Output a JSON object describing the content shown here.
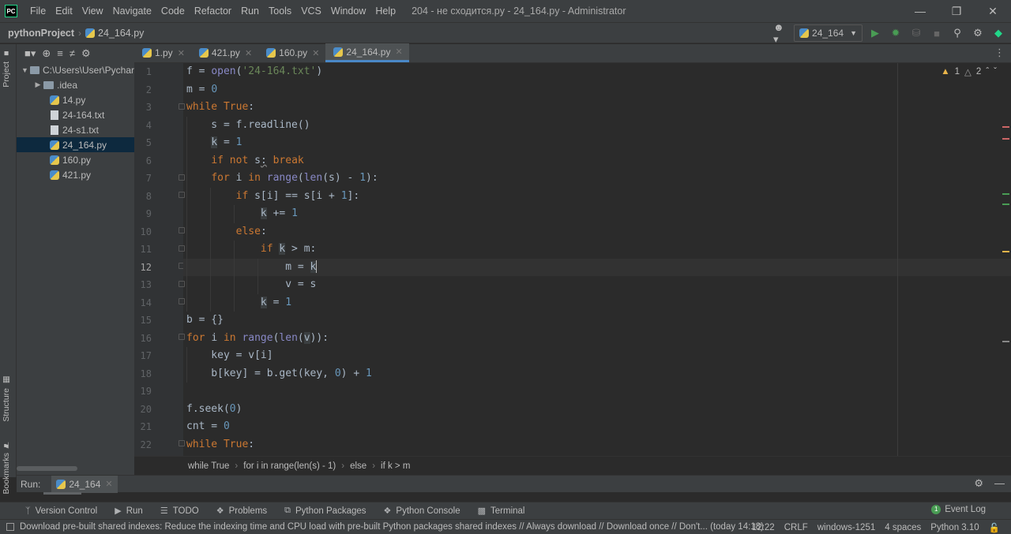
{
  "app": {
    "logo": "PC",
    "window_title": "204 - не сходится.py - 24_164.py - Administrator",
    "menu": [
      "File",
      "Edit",
      "View",
      "Navigate",
      "Code",
      "Refactor",
      "Run",
      "Tools",
      "VCS",
      "Window",
      "Help"
    ]
  },
  "navbar": {
    "project": "pythonProject",
    "file": "24_164.py",
    "run_config": "24_164"
  },
  "project_tree": {
    "root": "C:\\Users\\User\\Pychar",
    "items": [
      {
        "label": ".idea",
        "kind": "folder"
      },
      {
        "label": "14.py",
        "kind": "py"
      },
      {
        "label": "24-164.txt",
        "kind": "txt"
      },
      {
        "label": "24-s1.txt",
        "kind": "txt"
      },
      {
        "label": "24_164.py",
        "kind": "py",
        "selected": true
      },
      {
        "label": "160.py",
        "kind": "py"
      },
      {
        "label": "421.py",
        "kind": "py"
      }
    ]
  },
  "side_tabs": {
    "project": "Project",
    "structure": "Structure",
    "bookmarks": "Bookmarks"
  },
  "editor_tabs": [
    {
      "label": "1.py",
      "active": false
    },
    {
      "label": "421.py",
      "active": false
    },
    {
      "label": "160.py",
      "active": false
    },
    {
      "label": "24_164.py",
      "active": true
    }
  ],
  "inspections": {
    "warnings": "1",
    "weak_warnings": "2"
  },
  "code": {
    "current_line": 12,
    "line_numbers": [
      "1",
      "2",
      "3",
      "4",
      "5",
      "6",
      "7",
      "8",
      "9",
      "10",
      "11",
      "12",
      "13",
      "14",
      "15",
      "16",
      "17",
      "18",
      "19",
      "20",
      "21",
      "22"
    ]
  },
  "code_breadcrumbs": [
    "while True",
    "for i in range(len(s) - 1)",
    "else",
    "if k > m"
  ],
  "run_panel": {
    "label": "Run:",
    "tab": "24_164"
  },
  "tool_windows": [
    {
      "label": "Version Control",
      "icon": "branch-icon"
    },
    {
      "label": "Run",
      "icon": "run-icon"
    },
    {
      "label": "TODO",
      "icon": "list-icon"
    },
    {
      "label": "Problems",
      "icon": "problems-icon"
    },
    {
      "label": "Python Packages",
      "icon": "packages-icon"
    },
    {
      "label": "Python Console",
      "icon": "console-icon"
    },
    {
      "label": "Terminal",
      "icon": "terminal-icon"
    }
  ],
  "event_log": {
    "label": "Event Log",
    "badge": "1"
  },
  "status": {
    "message": "Download pre-built shared indexes: Reduce the indexing time and CPU load with pre-built Python packages shared indexes // Always download // Download once // Don't... (today 14:18)",
    "position": "12:22",
    "line_sep": "CRLF",
    "encoding": "windows-1251",
    "indent": "4 spaces",
    "interpreter": "Python 3.10"
  }
}
